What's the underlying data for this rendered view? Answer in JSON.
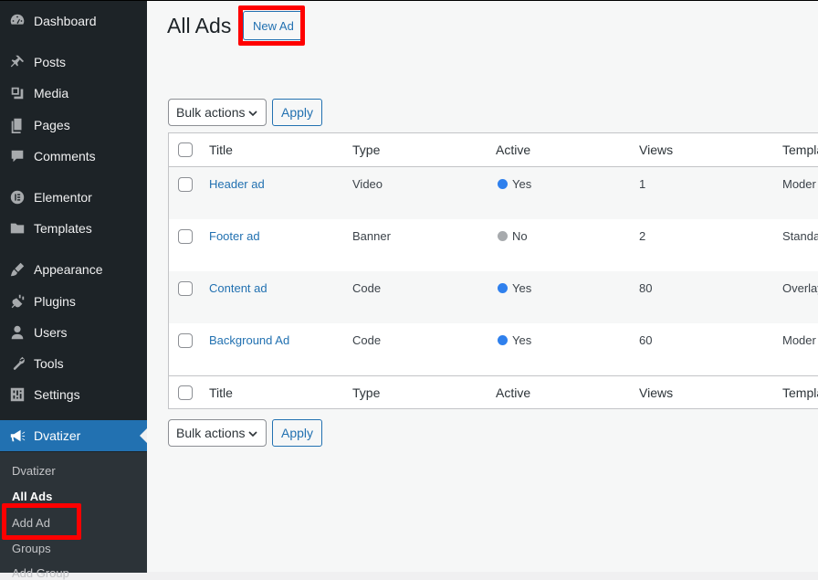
{
  "sidebar": {
    "items": [
      {
        "label": "Dashboard",
        "icon": "dashboard-icon"
      },
      {
        "label": "Posts",
        "icon": "pin-icon"
      },
      {
        "label": "Media",
        "icon": "media-icon"
      },
      {
        "label": "Pages",
        "icon": "pages-icon"
      },
      {
        "label": "Comments",
        "icon": "comment-icon"
      },
      {
        "label": "Elementor",
        "icon": "elementor-icon"
      },
      {
        "label": "Templates",
        "icon": "folder-icon"
      },
      {
        "label": "Appearance",
        "icon": "brush-icon"
      },
      {
        "label": "Plugins",
        "icon": "plug-icon"
      },
      {
        "label": "Users",
        "icon": "user-icon"
      },
      {
        "label": "Tools",
        "icon": "wrench-icon"
      },
      {
        "label": "Settings",
        "icon": "settings-icon"
      },
      {
        "label": "Dvatizer",
        "icon": "megaphone-icon"
      }
    ],
    "submenu": [
      "Dvatizer",
      "All Ads",
      "Add Ad",
      "Groups",
      "Add Group"
    ]
  },
  "main": {
    "title": "All Ads",
    "new_button": "New Ad",
    "bulk_actions": "Bulk actions",
    "apply": "Apply",
    "columns": [
      "Title",
      "Type",
      "Active",
      "Views",
      "Templa"
    ],
    "rows": [
      {
        "title": "Header ad",
        "type": "Video",
        "active": "Yes",
        "views": "1",
        "template": "Moder"
      },
      {
        "title": "Footer ad",
        "type": "Banner",
        "active": "No",
        "views": "2",
        "template": "Standa"
      },
      {
        "title": "Content ad",
        "type": "Code",
        "active": "Yes",
        "views": "80",
        "template": "Overlay"
      },
      {
        "title": "Background Ad",
        "type": "Code",
        "active": "Yes",
        "views": "60",
        "template": "Moder"
      }
    ]
  },
  "colors": {
    "sidebar_bg": "#1d2327",
    "accent": "#2271b1",
    "active_dot": "#2f80ed",
    "inactive_dot": "#a7aaad",
    "highlight": "#ff0000"
  }
}
